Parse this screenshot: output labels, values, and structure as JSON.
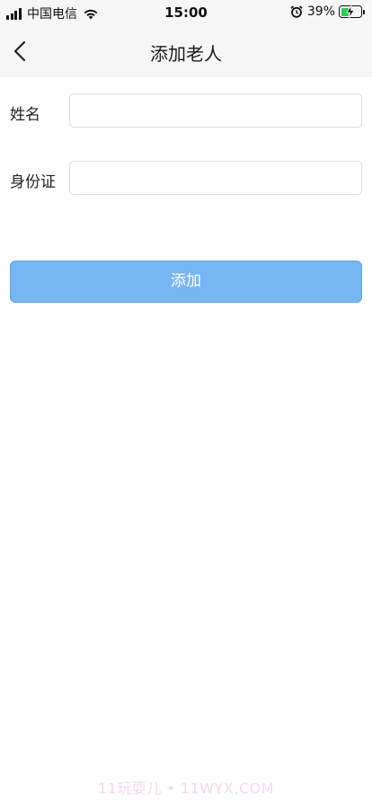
{
  "status_bar": {
    "carrier": "中国电信",
    "time": "15:00",
    "battery_percent": "39%",
    "battery_level": 0.39,
    "icons": [
      "signal-icon",
      "wifi-icon",
      "alarm-icon",
      "battery-charging-icon"
    ]
  },
  "nav": {
    "back_icon": "chevron-left-icon",
    "title": "添加老人"
  },
  "form": {
    "name_label": "姓名",
    "name_value": "",
    "id_label": "身份证",
    "id_value": "",
    "submit_label": "添加"
  },
  "watermark": "11玩耍儿 • 11WYX.COM",
  "colors": {
    "button_bg": "#75b6f3",
    "topbar_bg": "#f6f6f6",
    "input_border": "#dcdcdc"
  }
}
